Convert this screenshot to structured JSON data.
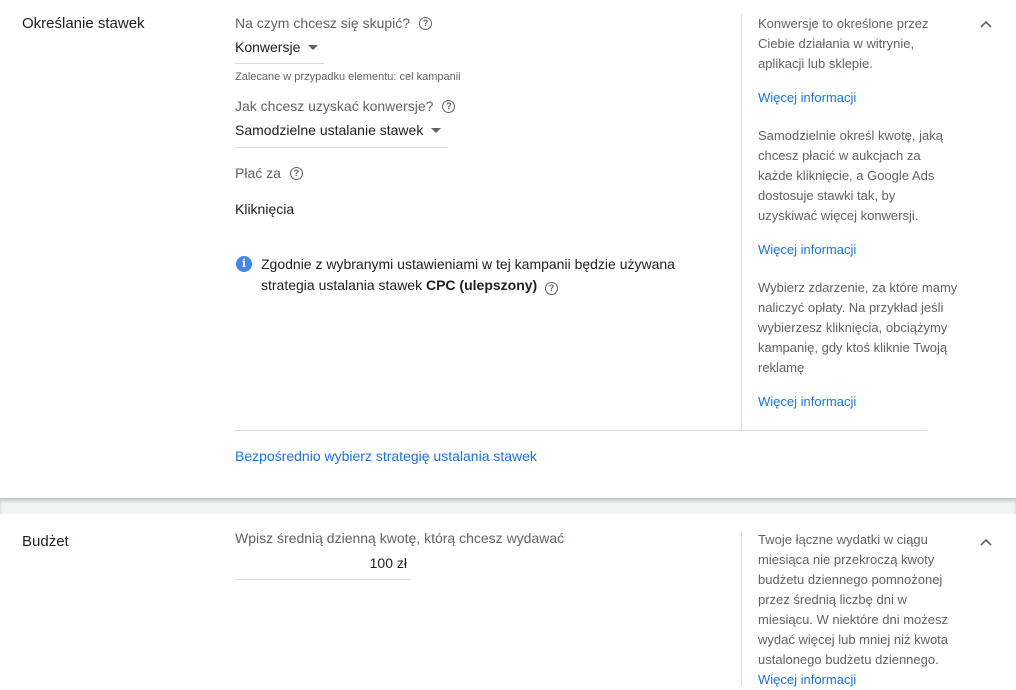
{
  "bidding": {
    "title": "Określanie stawek",
    "focus_label": "Na czym chcesz się skupić?",
    "focus_value": "Konwersje",
    "focus_hint": "Zalecane w przypadku elementu: cel kampanii",
    "how_label": "Jak chcesz uzyskać konwersje?",
    "how_value": "Samodzielne ustalanie stawek",
    "pay_label": "Płać za",
    "pay_value": "Kliknięcia",
    "info_text": "Zgodnie z wybranymi ustawieniami w tej kampanii będzie używana strategia ustalania stawek ",
    "info_bold": "CPC (ulepszony)",
    "direct_link": "Bezpośrednio wybierz strategię ustalania stawek",
    "side": {
      "text1": "Konwersje to określone przez Ciebie działania w witrynie, aplikacji lub sklepie.",
      "link1": "Więcej informacji",
      "text2": "Samodzielnie określ kwotę, jaką chcesz płacić w aukcjach za każde kliknięcie, a Google Ads dostosuje stawki tak, by uzyskiwać więcej konwersji.",
      "link2": "Więcej informacji",
      "text3": "Wybierz zdarzenie, za które mamy naliczyć opłaty. Na przykład jeśli wybierzesz kliknięcia, obciążymy kampanię, gdy ktoś kliknie Twoją reklamę",
      "link3": "Więcej informacji"
    }
  },
  "budget": {
    "title": "Budżet",
    "input_label": "Wpisz średnią dzienną kwotę, którą chcesz wydawać",
    "input_value": "100 zł",
    "side_text": "Twoje łączne wydatki w ciągu miesiąca nie przekroczą kwoty budżetu dziennego pomnożonej przez średnią liczbę dni w miesiącu. W niektóre dni możesz wydać więcej lub mniej niż kwota ustalonego budżetu dziennego. ",
    "side_link": "Więcej informacji"
  },
  "icons": {
    "help": "help-circle-icon",
    "info": "info-icon",
    "collapse": "chevron-up-icon",
    "dropdown": "caret-down-icon"
  },
  "colors": {
    "link": "#1a73e8",
    "info": "#4285f4"
  }
}
